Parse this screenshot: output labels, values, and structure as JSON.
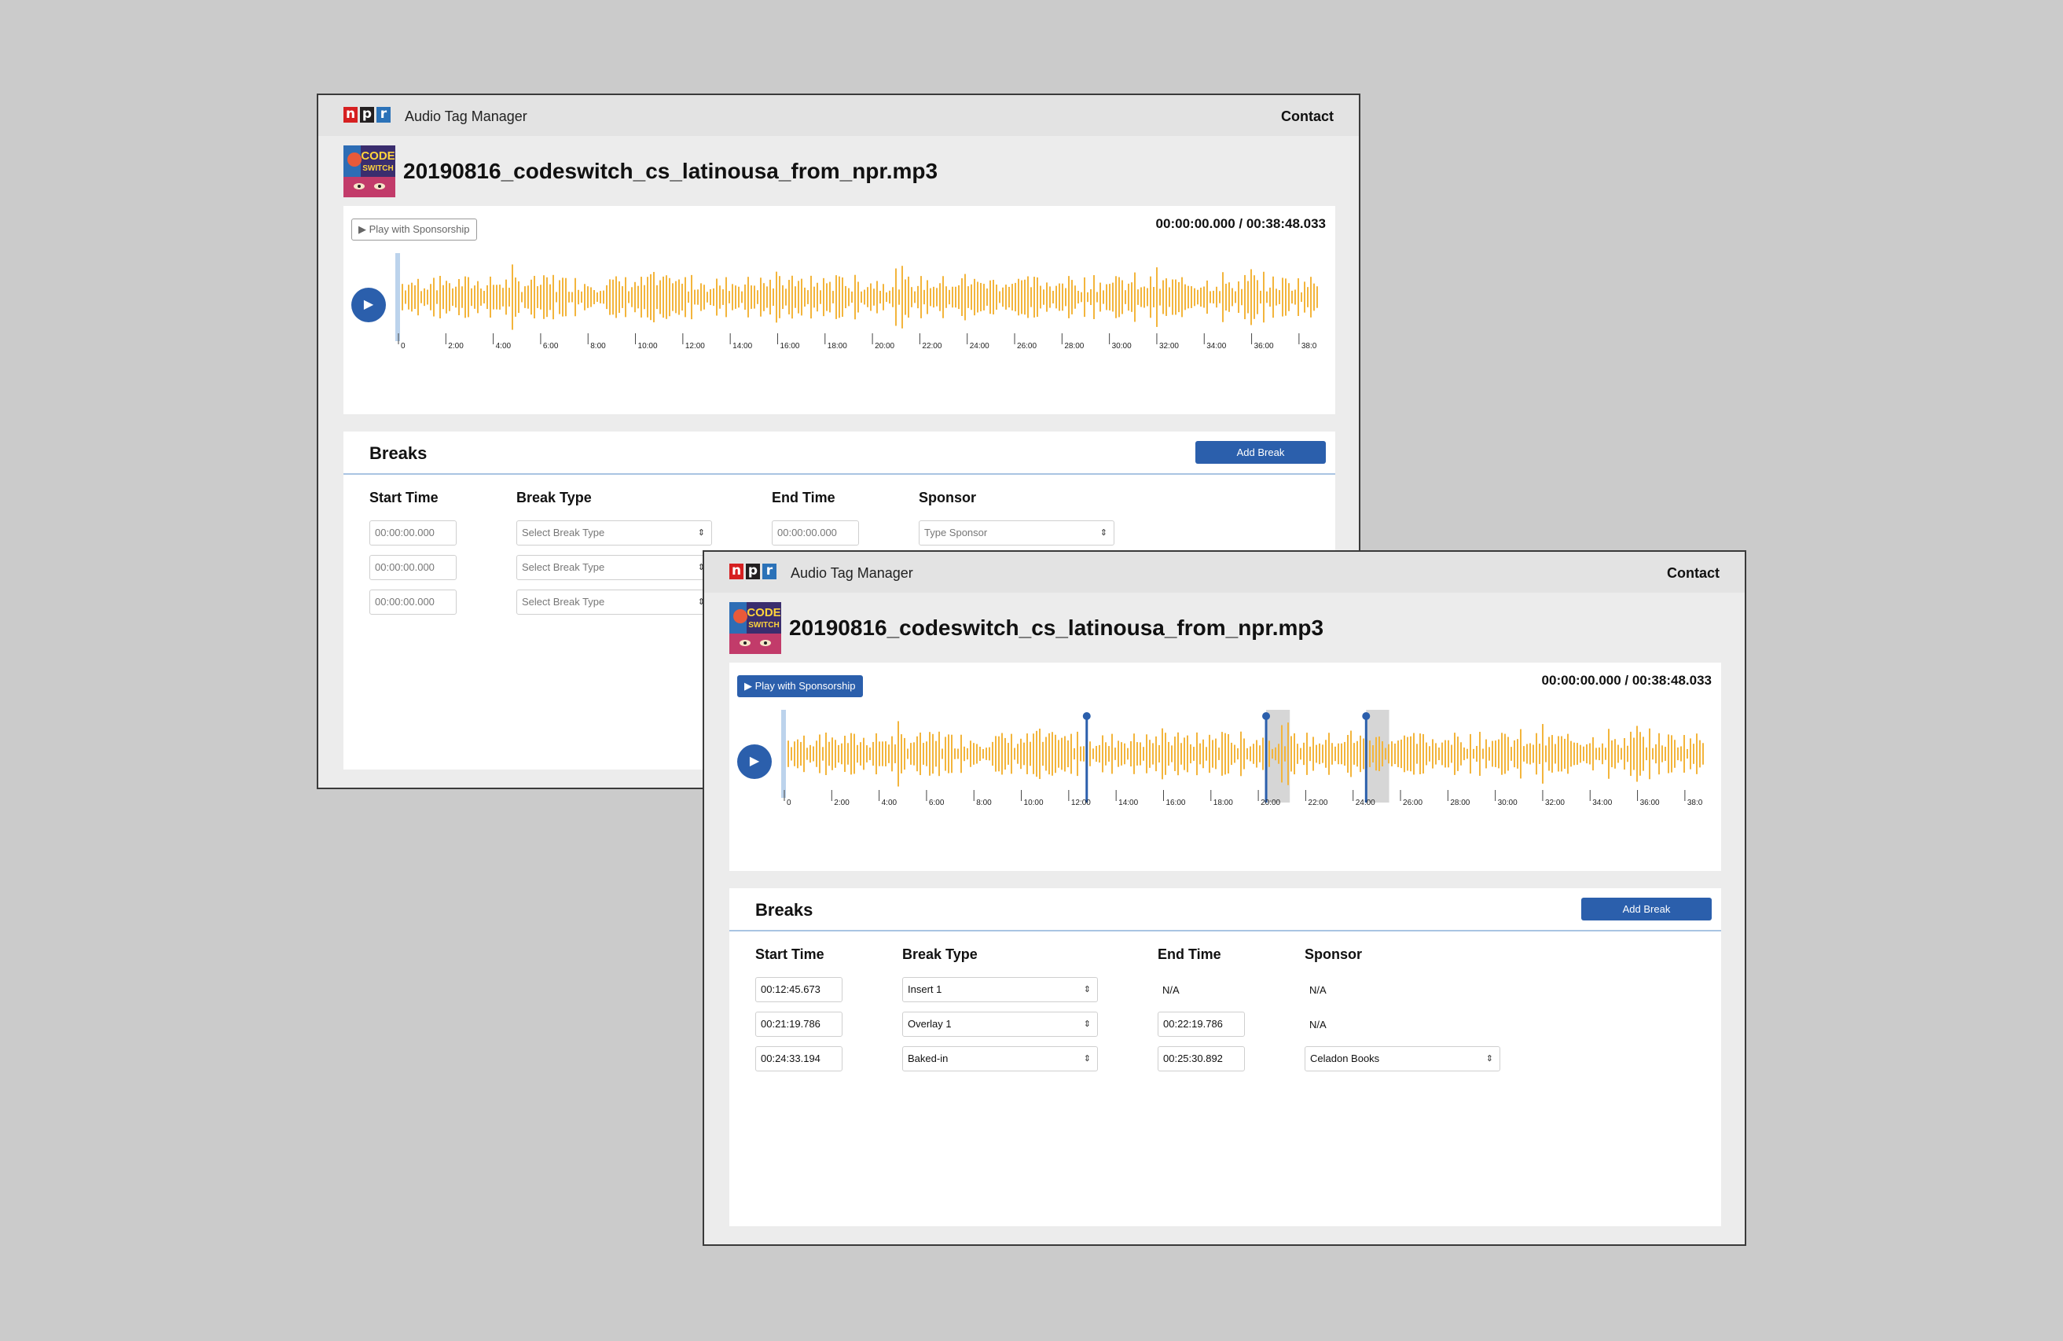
{
  "app": {
    "title": "Audio Tag Manager",
    "contact": "Contact",
    "logo_letters": [
      "n",
      "p",
      "r"
    ]
  },
  "file": {
    "name": "20190816_codeswitch_cs_latinousa_from_npr.mp3",
    "cover_text": [
      "CODE",
      "SWITCH"
    ]
  },
  "player": {
    "play_with_sponsorship": "▶ Play with Sponsorship",
    "timecode": "00:00:00.000 / 00:38:48.033",
    "play_icon": "▶",
    "timeline_labels": [
      "0",
      "2:00",
      "4:00",
      "6:00",
      "8:00",
      "10:00",
      "12:00",
      "14:00",
      "16:00",
      "18:00",
      "20:00",
      "22:00",
      "24:00",
      "26:00",
      "28:00",
      "30:00",
      "32:00",
      "34:00",
      "36:00",
      "38:0"
    ]
  },
  "breaks": {
    "title": "Breaks",
    "add_button": "Add Break",
    "headers": {
      "start": "Start Time",
      "type": "Break Type",
      "end": "End Time",
      "sponsor": "Sponsor"
    }
  },
  "back_window": {
    "rows": [
      {
        "start": "00:00:00.000",
        "type": "Select Break Type",
        "end": "00:00:00.000",
        "sponsor": "Type Sponsor"
      },
      {
        "start": "00:00:00.000",
        "type": "Select Break Type"
      },
      {
        "start": "00:00:00.000",
        "type": "Select Break Type"
      }
    ]
  },
  "front_window": {
    "rows": [
      {
        "start": "00:12:45.673",
        "type": "Insert 1",
        "end": "N/A",
        "sponsor": "N/A"
      },
      {
        "start": "00:21:19.786",
        "type": "Overlay 1",
        "end": "00:22:19.786",
        "sponsor": "N/A"
      },
      {
        "start": "00:24:33.194",
        "type": "Baked-in",
        "end": "00:25:30.892",
        "sponsor": "Celadon Books"
      }
    ],
    "break_markers_minutes": [
      12.76,
      20.33,
      24.55
    ],
    "shaded_ranges_minutes": [
      [
        20.33,
        21.33
      ],
      [
        24.55,
        25.52
      ]
    ]
  },
  "colors": {
    "accent": "#2b5fac",
    "waveform": "#f3b53c",
    "npr_red": "#d62021",
    "npr_black": "#231f20",
    "npr_blue": "#2b72b8"
  },
  "icons": {
    "select_arrows": "⇕"
  }
}
